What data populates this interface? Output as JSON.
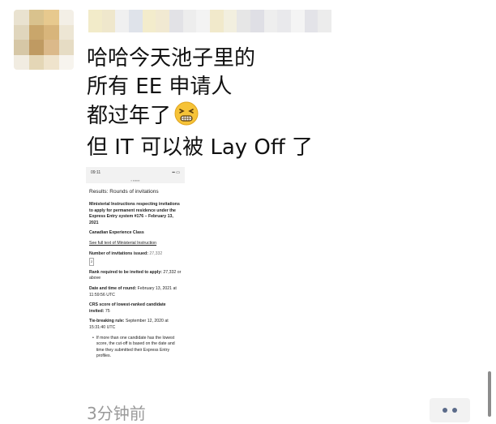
{
  "post": {
    "lines": [
      "哈哈今天池子里的",
      "所有 EE 申请人",
      "都过年了",
      "但 IT 可以被 Lay Off 了"
    ],
    "emoji": "grimacing-face-emoji",
    "time": "3分钟前"
  },
  "screenshot": {
    "status_time": "09:11",
    "title": "Results: Rounds of invitations",
    "heading": "Ministerial Instructions respecting invitations to apply for permanent residence under the Express Entry system #176 – February 13, 2021",
    "program": "Canadian Experience Class",
    "full_text_link": "See full text of Ministerial Instruction",
    "invitations_label": "Number of invitations issued:",
    "invitations_value": "27,332",
    "invitations_footnote": "2",
    "rank_label": "Rank required to be invited to apply:",
    "rank_value": "27,332",
    "rank_suffix": "or above",
    "round_label": "Date and time of round:",
    "round_value": "February 13, 2021 at 11:59:56 UTC",
    "crs_label": "CRS score of lowest-ranked candidate invited:",
    "crs_value": "75",
    "tie_label": "Tie-breaking rule:",
    "tie_value": "September 12, 2020 at 15:31:40 UTC",
    "bullet": "If more than one candidate has the lowest score, the cut-off is based on the date and time they submitted their Express Entry profiles."
  },
  "colors": {
    "text": "#111111",
    "timestamp": "#9a9a9a",
    "more_dots": "#5b6b8a",
    "more_bg": "#f2f2f2"
  },
  "icons": {
    "more": "more-dots-icon"
  }
}
